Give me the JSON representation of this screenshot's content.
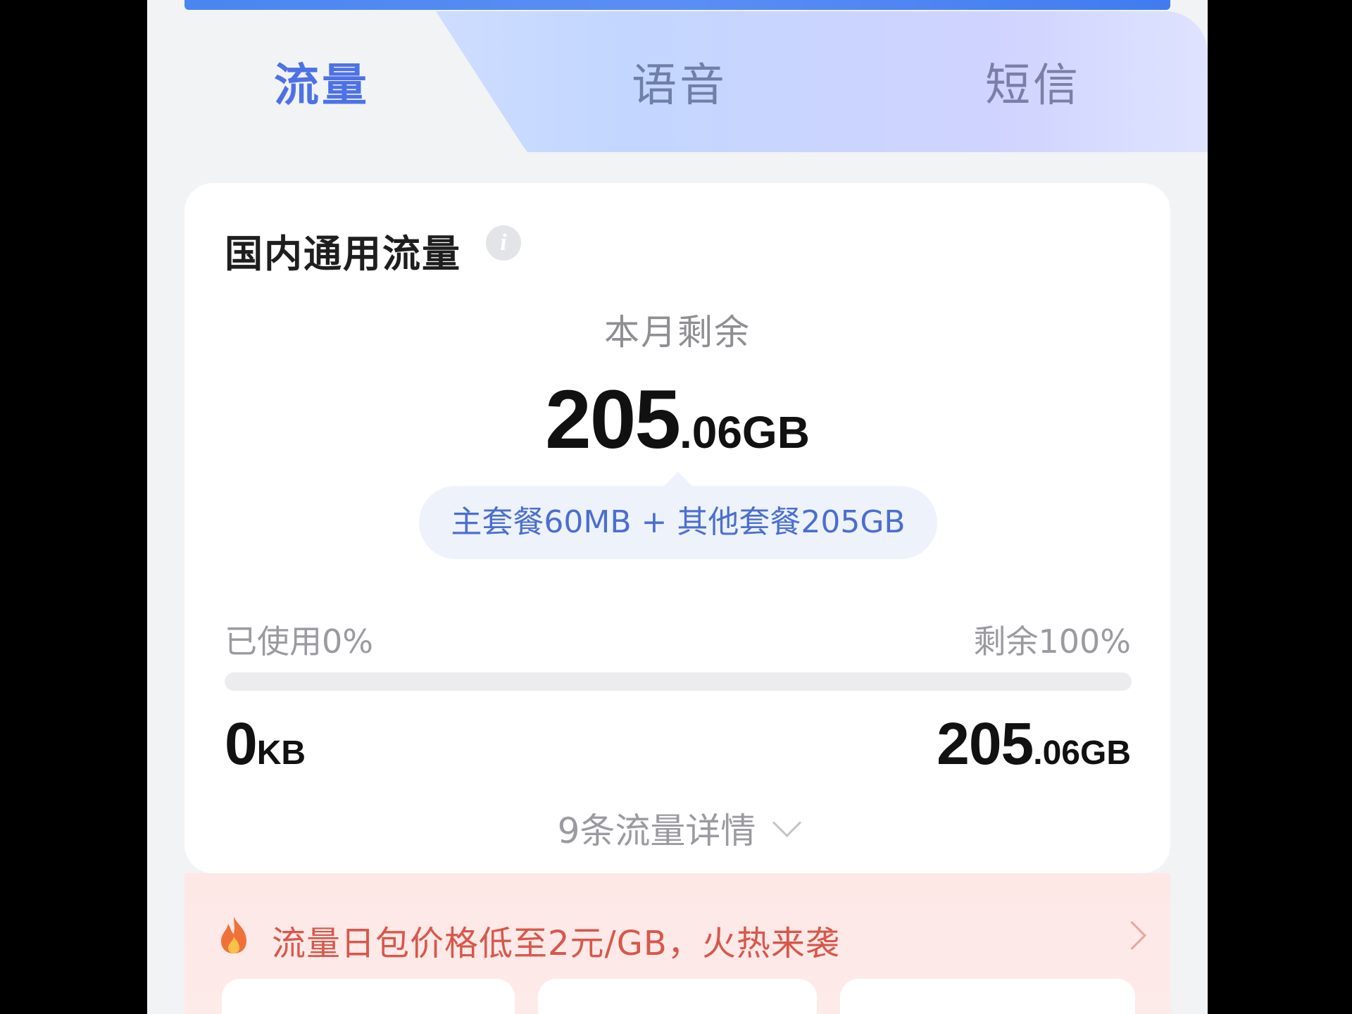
{
  "tabs": [
    {
      "label": "流量"
    },
    {
      "label": "语音"
    },
    {
      "label": "短信"
    }
  ],
  "card": {
    "title": "国内通用流量",
    "remaining_label": "本月剩余",
    "remaining_int": "205",
    "remaining_decimal_unit": ".06GB",
    "breakdown": "主套餐60MB + 其他套餐205GB",
    "used_percent_label": "已使用0%",
    "remaining_percent_label": "剩余100%",
    "used_fraction": 0,
    "min_int": "0",
    "min_unit": "KB",
    "max_int": "205",
    "max_unit": ".06GB",
    "details_link": "9条流量详情"
  },
  "promo": {
    "text": "流量日包价格低至2元/GB，火热来袭"
  },
  "icons": {
    "info": "info-icon",
    "fire": "fire-icon",
    "chevron_down": "chevron-down-icon",
    "chevron_right": "chevron-right-icon"
  },
  "colors": {
    "accent": "#4d72e6",
    "promo_text": "#d8574a"
  }
}
